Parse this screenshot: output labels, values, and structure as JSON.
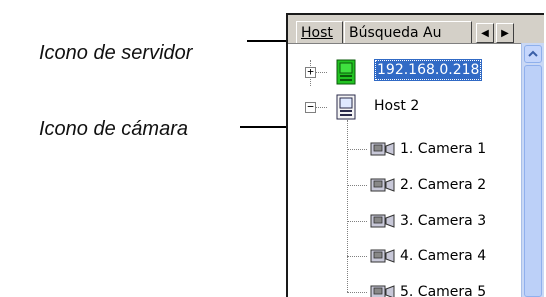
{
  "annotations": {
    "server_icon_label": "Icono de servidor",
    "camera_icon_label": "Icono de cámara"
  },
  "tabs": [
    {
      "label": "Host",
      "active": true
    },
    {
      "label": "Búsqueda Au",
      "active": false
    }
  ],
  "tab_scroll": {
    "left_icon": "triangle-left-icon",
    "right_icon": "triangle-right-icon"
  },
  "tree": {
    "hosts": [
      {
        "label": "192.168.0.218",
        "icon": "server-online-icon",
        "expanded": false,
        "selected": true
      },
      {
        "label": "Host 2",
        "icon": "server-icon",
        "expanded": true,
        "selected": false
      }
    ],
    "cameras": [
      {
        "label": "1. Camera 1"
      },
      {
        "label": "2. Camera 2"
      },
      {
        "label": "3. Camera 3"
      },
      {
        "label": "4. Camera 4"
      },
      {
        "label": "5. Camera 5"
      }
    ]
  },
  "colors": {
    "selection": "#316ac5",
    "server_online": "#22c322",
    "scrollbar": "#c9d8f5"
  }
}
